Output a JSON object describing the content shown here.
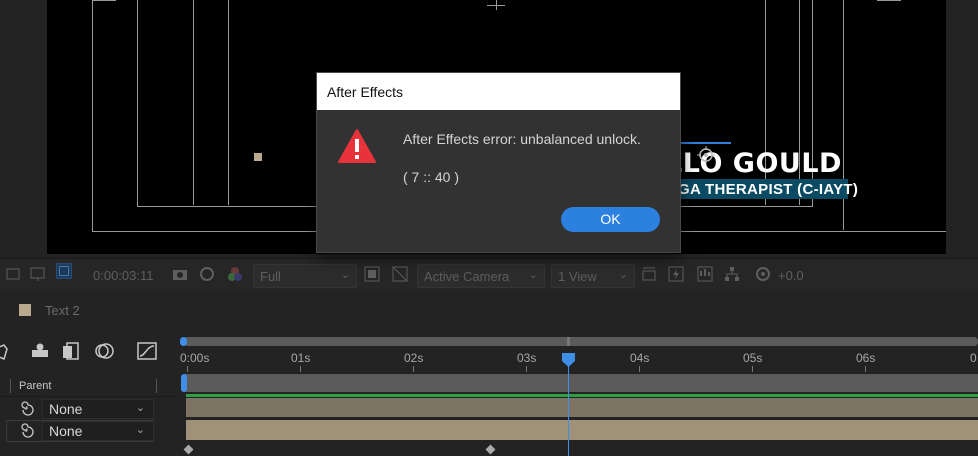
{
  "colors": {
    "accent": "#2b80e0",
    "warning": "#e8333a",
    "track_green": "#2ea043",
    "lower_third_bar": "#0a4a63"
  },
  "composition": {
    "lower_third": {
      "name": "LLO GOULD",
      "subtitle": "GA THERAPIST (C-IAYT)"
    }
  },
  "viewer_toolbar": {
    "timecode": "0:00:03:11",
    "resolution": "Full",
    "camera": "Active Camera",
    "views": "1 View",
    "exposure": "+0.0",
    "icons": [
      "region-of-interest-icon",
      "transparency-grid-icon",
      "snapshot-icon",
      "show-snapshot-icon",
      "color-channel-icon",
      "fast-preview-icon",
      "flowchart-icon",
      "reset-exposure-icon"
    ]
  },
  "timeline": {
    "tab_label": "Text 2",
    "ruler_labels": [
      "0:00s",
      "01s",
      "02s",
      "03s",
      "04s",
      "05s",
      "06s",
      "0"
    ],
    "column_header": "Parent",
    "rows": [
      {
        "parent": "None"
      },
      {
        "parent": "None"
      }
    ]
  },
  "dialog": {
    "title": "After Effects",
    "message": "After Effects error: unbalanced unlock.",
    "code": "( 7 :: 40 )",
    "ok_label": "OK",
    "icon": "warning-triangle-icon"
  }
}
